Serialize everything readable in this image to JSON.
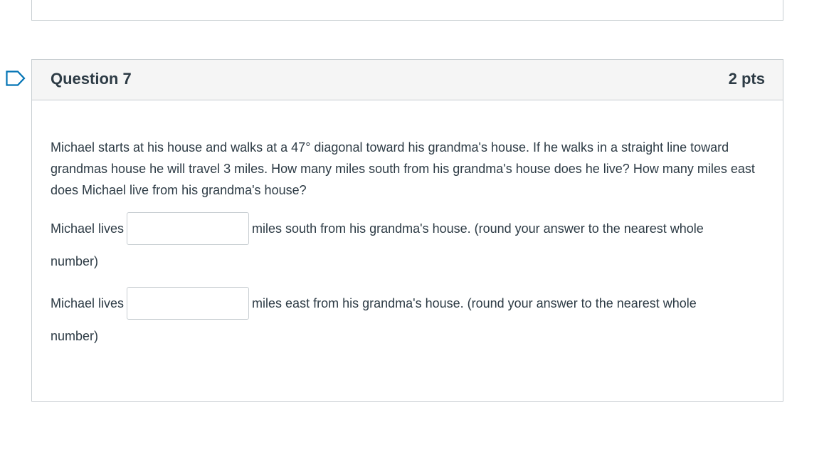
{
  "question": {
    "title": "Question 7",
    "points": "2 pts",
    "text": "Michael starts at his house and walks at a 47° diagonal toward his grandma's house. If he walks in a straight line toward grandmas house he will travel 3 miles. How many miles south from his grandma's house does he live? How many miles east does Michael live from his grandma's house?",
    "answers": [
      {
        "prefix": "Michael lives",
        "value": "",
        "suffix": "miles south from his grandma's house. (round your answer to the nearest whole",
        "continuation": "number)"
      },
      {
        "prefix": "Michael lives",
        "value": "",
        "suffix": "miles east from his grandma's house. (round your answer to the nearest whole",
        "continuation": "number)"
      }
    ]
  },
  "colors": {
    "accent": "#0374b5",
    "text": "#2d3b45",
    "border": "#c7cdd1",
    "header_bg": "#f5f5f5"
  }
}
